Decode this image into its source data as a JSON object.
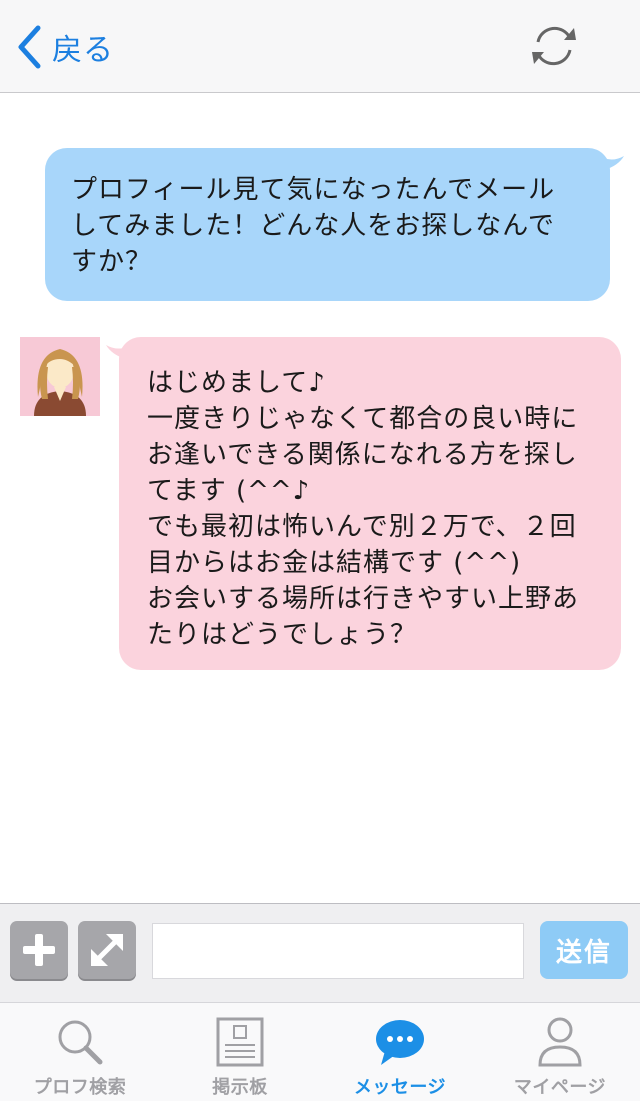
{
  "header": {
    "back_label": "戻る",
    "back_icon": "chevron-left-icon",
    "refresh_icon": "refresh-icon"
  },
  "chat": {
    "messages": [
      {
        "sender": "me",
        "lines": [
          "プロフィール見て気になったんでメール",
          "してみました！どんな人をお探しなんで",
          "すか？"
        ]
      },
      {
        "sender": "partner",
        "lines": [
          "はじめまして♪",
          "一度きりじゃなくて都合の良い時に",
          "お逢いできる関係になれる方を探し",
          "てます (^^♪",
          "でも最初は怖いんで別２万で、２回",
          "目からはお金は結構です (^^)",
          "お会いする場所は行きやすい上野あ",
          "たりはどうでしょう？"
        ]
      }
    ]
  },
  "composer": {
    "input_value": "",
    "send_label": "送信",
    "add_icon": "plus-icon",
    "expand_icon": "expand-icon"
  },
  "tabs": [
    {
      "label": "プロフ検索",
      "icon": "search-icon",
      "active": false
    },
    {
      "label": "掲示板",
      "icon": "bulletin-board-icon",
      "active": false
    },
    {
      "label": "メッセージ",
      "icon": "chat-bubble-icon",
      "active": true
    },
    {
      "label": "マイページ",
      "icon": "person-icon",
      "active": false
    }
  ],
  "colors": {
    "accent": "#1c8fe6",
    "outgoing_bubble": "#a8d6fa",
    "incoming_bubble": "#fbd3dd",
    "send_button": "#8ecbf6"
  }
}
